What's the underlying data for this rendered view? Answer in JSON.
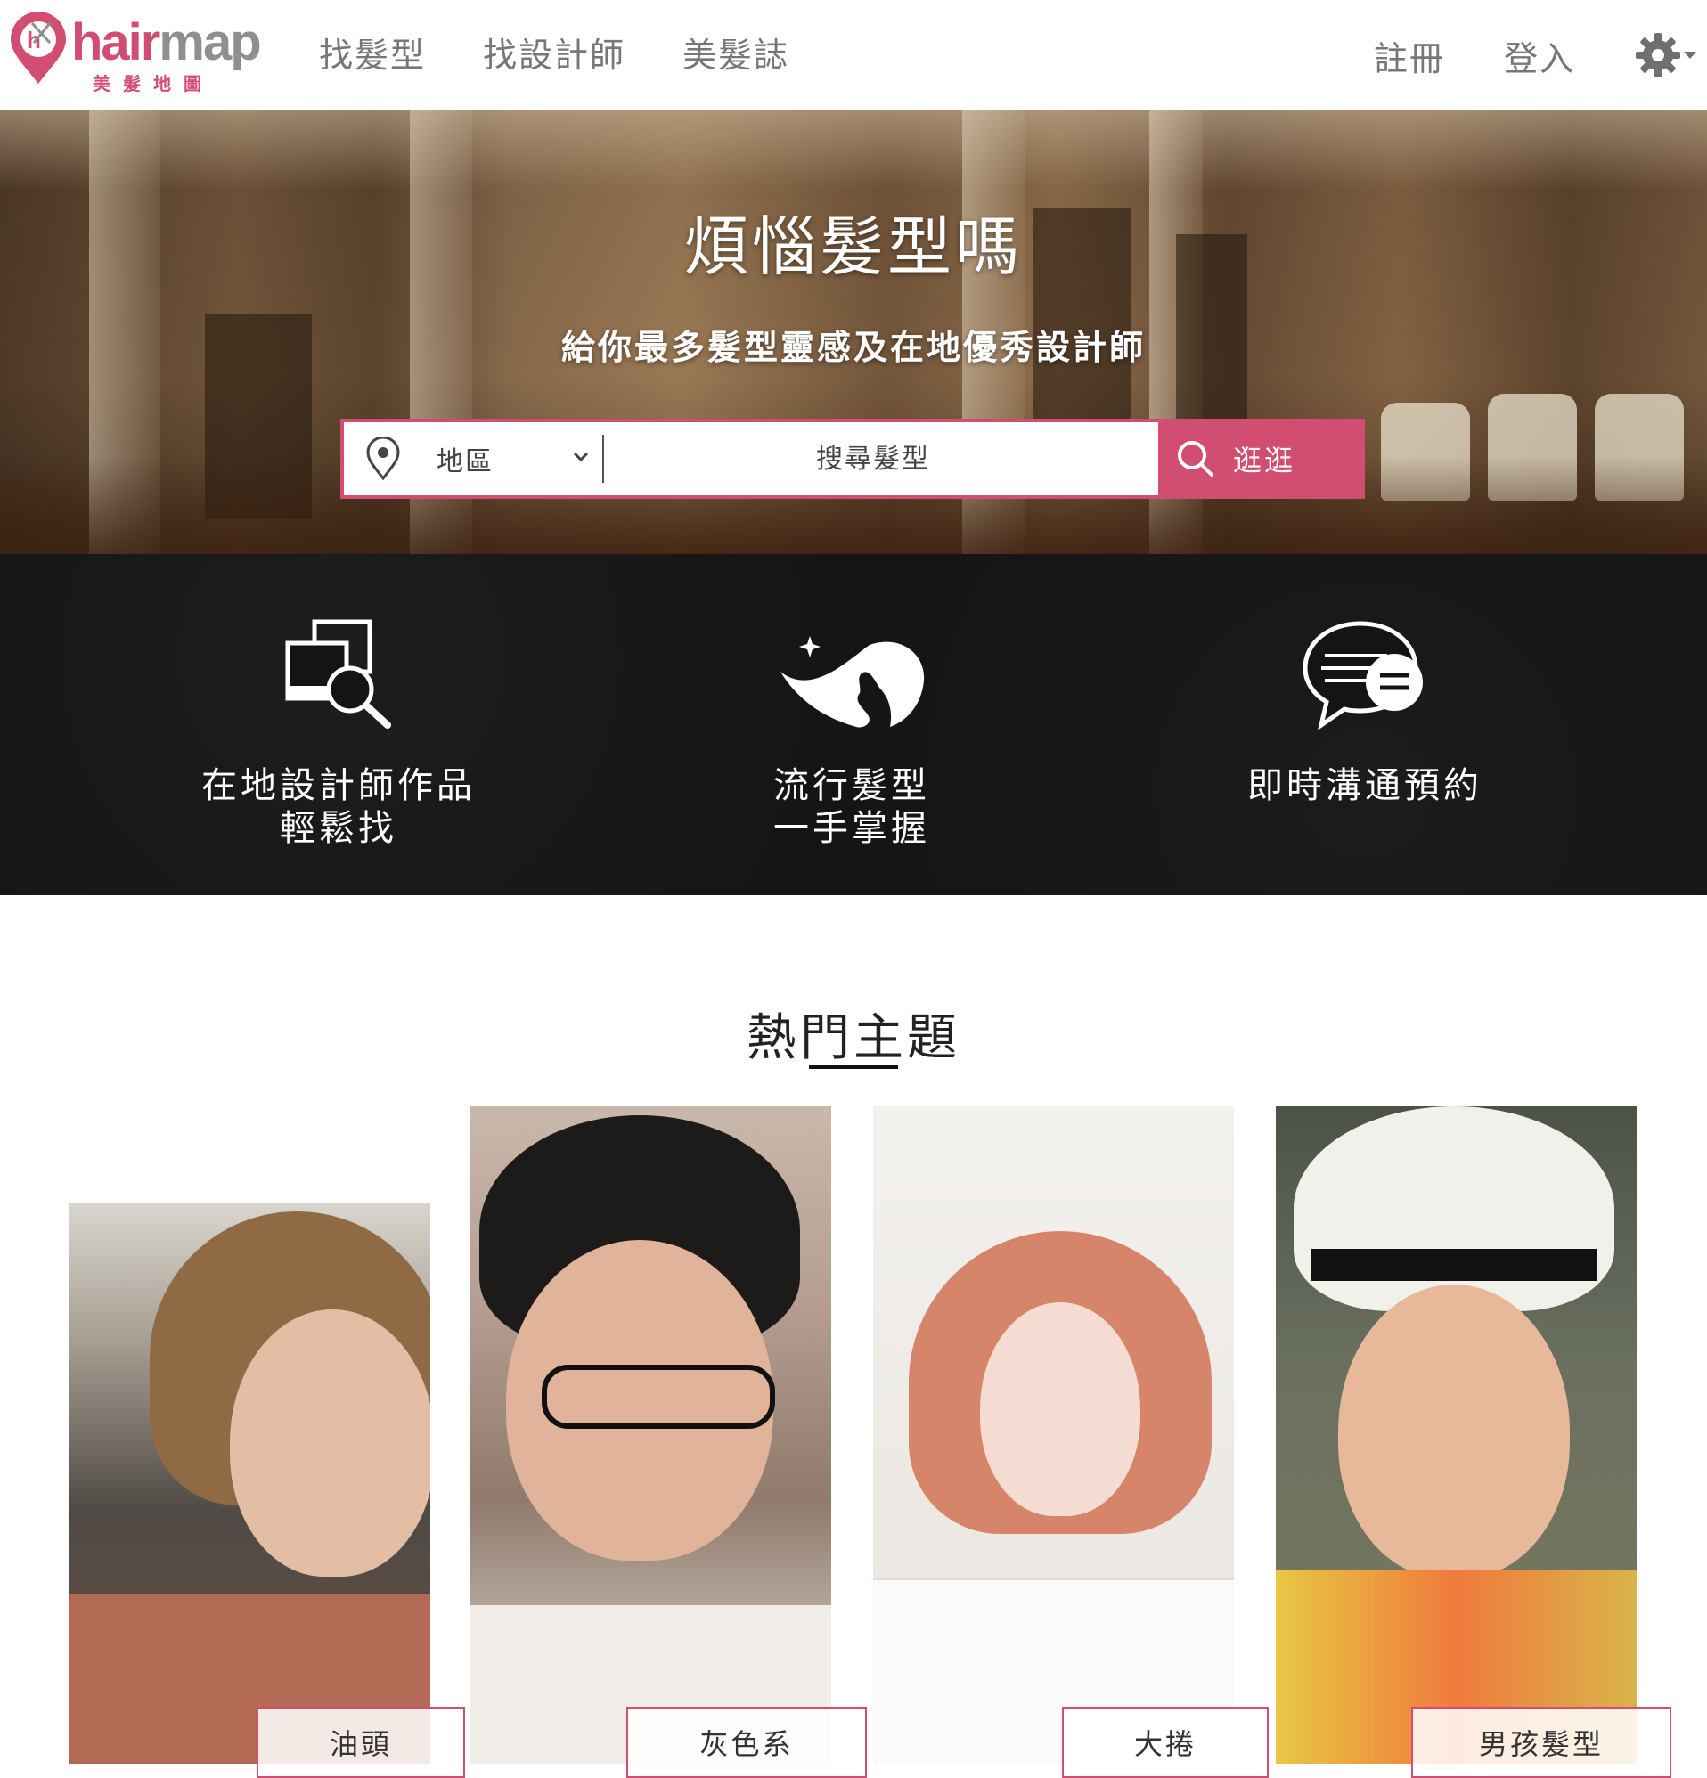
{
  "brand": {
    "logo_word_hair": "hair",
    "logo_word_map": "map",
    "logo_sub": "美髮地圖",
    "color": "#d24d72"
  },
  "nav": {
    "items": [
      "找髮型",
      "找設計師",
      "美髮誌"
    ]
  },
  "account": {
    "register": "註冊",
    "login": "登入"
  },
  "hero": {
    "title": "煩惱髮型嗎",
    "subtitle": "給你最多髮型靈感及在地優秀設計師",
    "area_label": "地區",
    "search_placeholder": "搜尋髮型",
    "search_button": "逛逛"
  },
  "features": [
    {
      "icon": "image-search-icon",
      "line1": "在地設計師作品",
      "line2": "輕鬆找"
    },
    {
      "icon": "hair-profile-icon",
      "line1": "流行髮型",
      "line2": "一手掌握"
    },
    {
      "icon": "chat-icon",
      "line1": "即時溝通預約",
      "line2": ""
    }
  ],
  "hot_topics": {
    "title": "熱門主題",
    "cards": [
      {
        "tag": "油頭"
      },
      {
        "tag": "灰色系"
      },
      {
        "tag": "大捲"
      },
      {
        "tag": "男孩髮型"
      }
    ]
  }
}
